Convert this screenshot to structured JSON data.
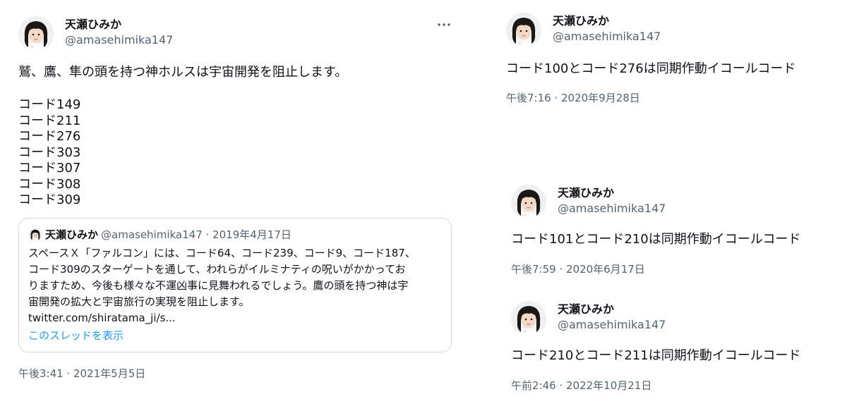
{
  "user": {
    "name": "天瀬ひみか",
    "handle": "@amasehimika147"
  },
  "tweet_main": {
    "text": "鷲、鷹、隼の頭を持つ神ホルスは宇宙開発を阻止します。",
    "codes": [
      "コード149",
      "コード211",
      "コード276",
      "コード303",
      "コード307",
      "コード308",
      "コード309"
    ],
    "time": "午後3:41 · 2021年5月5日",
    "more_icon": "more-horizontal-icon",
    "quote": {
      "name": "天瀬ひみか",
      "meta": "@amasehimika147 · 2019年4月17日",
      "lines": [
        "スペースＸ「ファルコン」には、コード64、コード239、コード9、コード187、",
        "コード309のスターゲートを通して、われらがイルミナティの呪いがかかってお",
        "りますため、今後も様々な不運凶事に見舞われるでしょう。鷹の頭を持つ神は宇",
        "宙開発の拡大と宇宙旅行の実現を阻止します。"
      ],
      "link": "twitter.com/shiratama_ji/s...",
      "show_thread": "このスレッドを表示"
    }
  },
  "tweet_a": {
    "text": "コード100とコード276は同期作動イコールコード",
    "time": "午後7:16 · 2020年9月28日"
  },
  "tweet_b": {
    "text": "コード101とコード210は同期作動イコールコード",
    "time": "午後7:59 · 2020年6月17日"
  },
  "tweet_c": {
    "text": "コード210とコード211は同期作動イコールコード",
    "time": "午前2:46 · 2022年10月21日"
  }
}
